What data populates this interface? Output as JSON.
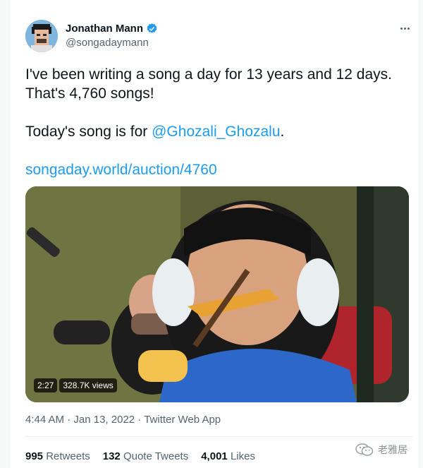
{
  "tweet": {
    "author": {
      "name": "Jonathan Mann",
      "handle": "@songadaymann",
      "avatar": "pixel-avatar",
      "verified_icon": "verified-badge-icon"
    },
    "menu_icon": "more-icon",
    "text": {
      "line1": "I've been writing a song a day for 13 years and 12 days.",
      "line2": "That's 4,760 songs!",
      "line3_prefix": "Today's song is for ",
      "mention": "@Ghozali_Ghozalu",
      "line3_suffix": ".",
      "link": "songaday.world/auction/4760"
    },
    "media": {
      "type": "video",
      "duration": "2:27",
      "views": "328.7K views"
    },
    "meta": {
      "time": "4:44 AM",
      "separator1": " · ",
      "date": "Jan 13, 2022",
      "separator2": " · ",
      "source": "Twitter Web App"
    },
    "stats": {
      "retweets_count": "995",
      "retweets_label": "Retweets",
      "quote_count": "132",
      "quote_label": "Quote Tweets",
      "likes_count": "4,001",
      "likes_label": "Likes"
    },
    "watermark": {
      "icon": "wechat-icon",
      "text": "老雅居"
    },
    "colors": {
      "accent": "#1d9bf0",
      "text": "#0f1419",
      "secondary": "#536471"
    }
  }
}
